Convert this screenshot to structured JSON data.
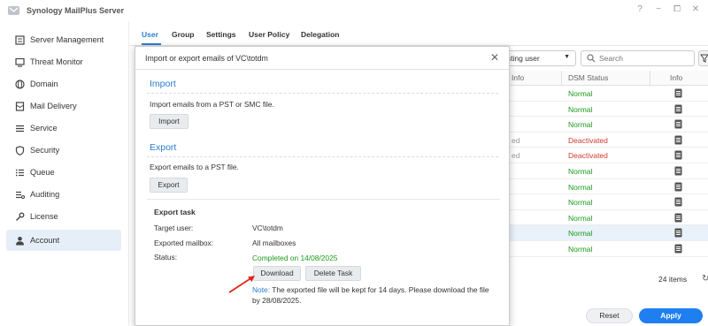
{
  "app": {
    "title": "Synology MailPlus Server",
    "window_controls": [
      "?",
      "−",
      "⧠",
      "✕"
    ]
  },
  "sidebar": {
    "items": [
      {
        "label": "Server Management",
        "icon": "server-icon"
      },
      {
        "label": "Threat Monitor",
        "icon": "monitor-icon"
      },
      {
        "label": "Domain",
        "icon": "globe-icon"
      },
      {
        "label": "Mail Delivery",
        "icon": "mail-icon"
      },
      {
        "label": "Service",
        "icon": "list-icon"
      },
      {
        "label": "Security",
        "icon": "shield-icon"
      },
      {
        "label": "Queue",
        "icon": "queue-icon"
      },
      {
        "label": "Auditing",
        "icon": "auditing-icon"
      },
      {
        "label": "License",
        "icon": "key-icon"
      },
      {
        "label": "Account",
        "icon": "user-icon",
        "active": true
      }
    ]
  },
  "tabs": [
    "User",
    "Group",
    "Settings",
    "User Policy",
    "Delegation"
  ],
  "toolbar": {
    "filter_value": "isting user",
    "search_placeholder": "Search"
  },
  "table": {
    "headers": {
      "col_info_partial": "Info",
      "dsm_status": "DSM Status",
      "info": "Info"
    },
    "rows": [
      {
        "frag": "",
        "status": "Normal"
      },
      {
        "frag": "",
        "status": "Normal"
      },
      {
        "frag": "",
        "status": "Normal"
      },
      {
        "frag": "ed",
        "status": "Deactivated"
      },
      {
        "frag": "ed",
        "status": "Deactivated"
      },
      {
        "frag": "",
        "status": "Normal"
      },
      {
        "frag": "",
        "status": "Normal"
      },
      {
        "frag": "",
        "status": "Normal"
      },
      {
        "frag": "",
        "status": "Normal"
      },
      {
        "frag": "",
        "status": "Normal",
        "selected": true
      },
      {
        "frag": "",
        "status": "Normal"
      }
    ],
    "count": "24 items"
  },
  "footer": {
    "reset": "Reset",
    "apply": "Apply"
  },
  "modal": {
    "title": "Import or export emails of VC\\totdm",
    "import_title": "Import",
    "import_desc": "Import emails from a PST or SMC file.",
    "import_btn": "Import",
    "export_title": "Export",
    "export_desc": "Export emails to a PST file.",
    "export_btn": "Export",
    "task": {
      "title": "Export task",
      "target_label": "Target user:",
      "target_value": "VC\\totdm",
      "mailbox_label": "Exported mailbox:",
      "mailbox_value": "All mailboxes",
      "status_label": "Status:",
      "status_value": "Completed on 14/08/2025",
      "download_btn": "Download",
      "delete_btn": "Delete Task",
      "note_label": "Note:",
      "note_text": " The exported file will be kept for 14 days. Please download the file by 28/08/2025."
    }
  },
  "colors": {
    "accent": "#2a7ed0",
    "normal": "#1a9a1a",
    "deactivated": "#d03a2a",
    "apply": "#1f7ff0",
    "annotation_arrow": "#e0241b"
  }
}
